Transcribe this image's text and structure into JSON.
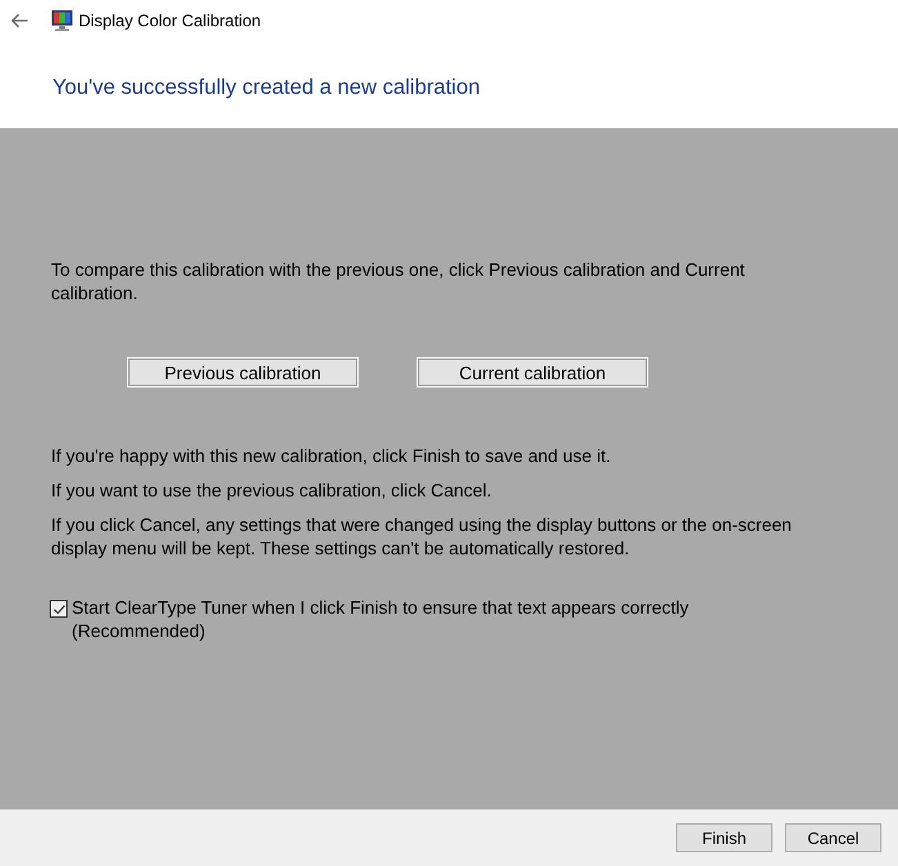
{
  "window": {
    "title": "Display Color Calibration"
  },
  "heading": "You've successfully created a new calibration",
  "compare": {
    "text": "To compare this calibration with the previous one, click Previous calibration and Current calibration.",
    "buttons": [
      "Previous calibration",
      "Current calibration"
    ]
  },
  "paragraphs": [
    "If you're happy with this new calibration, click Finish to save and use it.",
    "If you want to use the previous calibration, click Cancel.",
    "If you click Cancel, any settings that were changed using the display buttons or the on-screen display menu will be kept. These settings can't be automatically restored."
  ],
  "cleartype": {
    "label": "Start ClearType Tuner when I click Finish to ensure that text appears correctly (Recommended)",
    "checked": true
  },
  "footer": {
    "buttons": [
      "Finish",
      "Cancel"
    ]
  }
}
